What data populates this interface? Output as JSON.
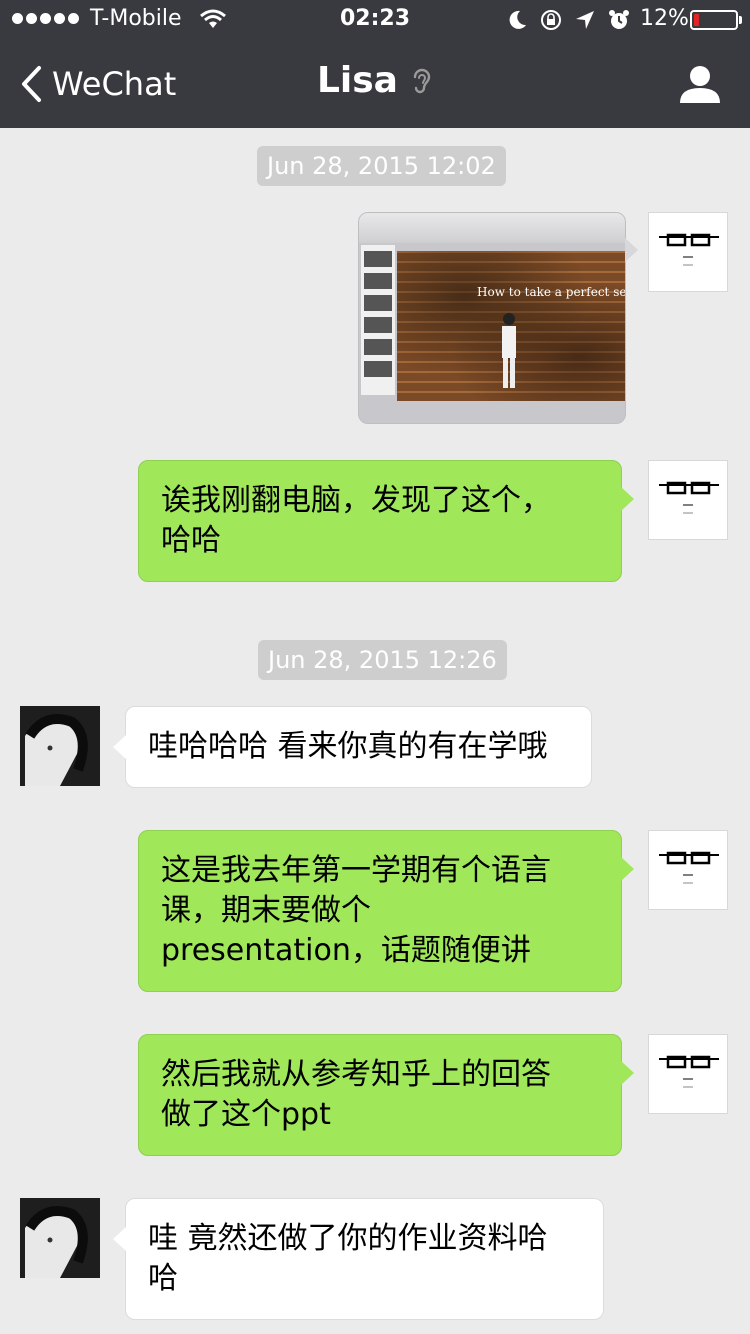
{
  "status_bar": {
    "carrier": "T-Mobile",
    "time": "02:23",
    "battery_percent": "12%",
    "battery_level": 0.12,
    "icons": [
      "wifi-icon",
      "moon-icon",
      "rotation-lock-icon",
      "location-arrow-icon",
      "alarm-icon",
      "battery-icon"
    ]
  },
  "nav": {
    "back_label": "WeChat",
    "title": "Lisa",
    "title_icon": "ear-icon",
    "right_icon": "profile-icon"
  },
  "messages": [
    {
      "type": "time",
      "text": "Jun 28, 2015 12:02"
    },
    {
      "type": "image",
      "from": "me",
      "slide_title": "How to take a perfect sel"
    },
    {
      "type": "text",
      "from": "me",
      "lines": [
        "诶我刚翻电脑，发现了这个，",
        "哈哈"
      ]
    },
    {
      "type": "time",
      "text": "Jun 28, 2015 12:26"
    },
    {
      "type": "text",
      "from": "lisa",
      "lines": [
        "哇哈哈哈 看来你真的有在学哦"
      ]
    },
    {
      "type": "text",
      "from": "me",
      "lines": [
        "这是我去年第一学期有个语言",
        "课，期末要做个",
        "presentation，话题随便讲"
      ]
    },
    {
      "type": "text",
      "from": "me",
      "lines": [
        "然后我就从参考知乎上的回答",
        "做了这个ppt"
      ]
    },
    {
      "type": "text",
      "from": "lisa",
      "lines": [
        "哇 竟然还做了你的作业资料哈",
        "哈"
      ]
    }
  ],
  "colors": {
    "nav_bg": "#393a3f",
    "chat_bg": "#ebebeb",
    "outgoing_bubble": "#a0e75a",
    "incoming_bubble": "#ffffff",
    "time_chip": "#cecece",
    "battery_low": "#e42424"
  }
}
